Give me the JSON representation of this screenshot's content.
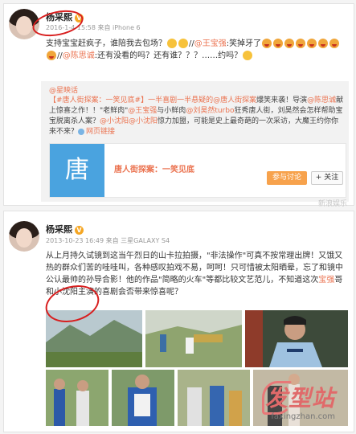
{
  "post1": {
    "username": "杨采熙",
    "vip": "V",
    "meta": "2016-1-4 15:58 来自 iPhone 6",
    "text_a": "支持宝宝赶疯子，谁陪我去包场？",
    "text_b": "//",
    "mention1": "@王宝强",
    "text_c": ":笑掉牙了",
    "text_d": "//",
    "mention2": "@陈思诚",
    "text_e": ":还有没看的吗？还有谁？？？……约吗？"
  },
  "repost": {
    "author": "@星映话",
    "line1_a": "【#唐人街探案：一笑见底#】一半喜剧一半悬疑的",
    "line1_b": "@唐人街探案",
    "line1_c": "爆笑来袭！导演",
    "line1_d": "@陈思诚",
    "line1_e": "献上惊喜之作！！\"老鲜肉\"",
    "line1_f": "@王宝强",
    "line1_g": "与小鲜肉",
    "line1_h": "@刘昊然turbo",
    "line1_i": "狂秀唐人街，刘昊然会怎样帮助宝宝脱离杀人案？",
    "line1_j": "@小沈阳",
    "line1_k": "@小沈阳",
    "line1_l": "惊力加盟，可能是史上最奇葩的一次采访，大魔王约你你来不来？",
    "link_label": "网页链接",
    "card_title": "唐人街探案：一笑见底",
    "card_thumb_text": "唐",
    "ticket_button": "参与讨论",
    "follow_button": "+ 关注",
    "watermark": "新浪娱乐"
  },
  "post2": {
    "username": "杨采熙",
    "vip": "V",
    "meta": "2013-10-23 16:49 来自 三星GALAXY S4",
    "text_a": "从上月持久试镜到这当午烈日的山卡拉拍摄，\"非法操作\"可真不按常理出牌！又饿又热的群众们苦的哇哇叫，各种感叹拍戏不易，呵呵！只可惜被太阳晒晕，忘了",
    "text_b": "和镜中公认最帅的孙导合影！他的作品\"简略的火车\"等都比较文艺范儿，不知道这次",
    "mention": "宝强",
    "text_c": "哥和小沈阳主演的喜剧会否带来惊喜呢？"
  },
  "site_watermark": {
    "logo": "发型站",
    "url": "faxingzhan.com"
  }
}
